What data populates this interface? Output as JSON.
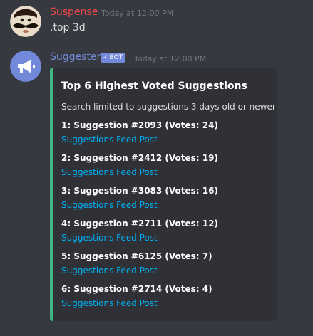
{
  "messages": [
    {
      "username": "Suspense",
      "username_color": "#f04747",
      "timestamp": "Today at 12:00 PM",
      "content": ".top 3d"
    },
    {
      "username": "Suggester",
      "username_color": "#7289da",
      "bot_tag": "BOT",
      "timestamp": "Today at 12:00 PM"
    }
  ],
  "embed": {
    "accent_color": "#43b581",
    "title": "Top 6 Highest Voted Suggestions",
    "description": "Search limited to suggestions 3 days old or newer",
    "fields": [
      {
        "name": "1: Suggestion #2093 (Votes: 24)",
        "link": "Suggestions Feed Post"
      },
      {
        "name": "2: Suggestion #2412 (Votes: 19)",
        "link": "Suggestions Feed Post"
      },
      {
        "name": "3: Suggestion #3083 (Votes: 16)",
        "link": "Suggestions Feed Post"
      },
      {
        "name": "4: Suggestion #2711 (Votes: 12)",
        "link": "Suggestions Feed Post"
      },
      {
        "name": "5: Suggestion #6125 (Votes: 7)",
        "link": "Suggestions Feed Post"
      },
      {
        "name": "6: Suggestion #2714 (Votes: 4)",
        "link": "Suggestions Feed Post"
      }
    ]
  },
  "icons": {
    "user_avatar": "mustache-face-avatar",
    "bot_avatar": "megaphone-avatar",
    "bot_check": "check-icon"
  }
}
